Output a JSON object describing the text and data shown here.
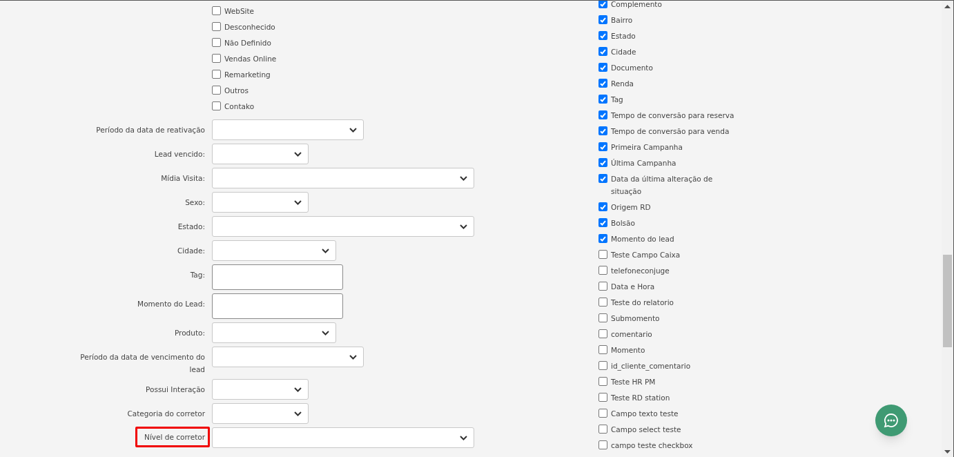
{
  "origin_options": [
    {
      "label": "WebSite",
      "checked": false
    },
    {
      "label": "Desconhecido",
      "checked": false
    },
    {
      "label": "Não Definido",
      "checked": false
    },
    {
      "label": "Vendas Online",
      "checked": false
    },
    {
      "label": "Remarketing",
      "checked": false
    },
    {
      "label": "Outros",
      "checked": false
    },
    {
      "label": "Contako",
      "checked": false
    }
  ],
  "filters": [
    {
      "label": "Período da data de reativação",
      "kind": "select",
      "highlighted": false
    },
    {
      "label": "Lead vencido:",
      "kind": "select",
      "highlighted": false
    },
    {
      "label": "Mídia Visita:",
      "kind": "select",
      "highlighted": false
    },
    {
      "label": "Sexo:",
      "kind": "select",
      "highlighted": false
    },
    {
      "label": "Estado:",
      "kind": "select",
      "highlighted": false
    },
    {
      "label": "Cidade:",
      "kind": "select",
      "highlighted": false
    },
    {
      "label": "Tag:",
      "kind": "textarea",
      "highlighted": false
    },
    {
      "label": "Momento do Lead:",
      "kind": "textarea",
      "highlighted": false
    },
    {
      "label": "Produto:",
      "kind": "select",
      "highlighted": false
    },
    {
      "label": "Período da data de vencimento do lead",
      "kind": "select",
      "highlighted": false
    },
    {
      "label": "Possui Interação",
      "kind": "select",
      "highlighted": false
    },
    {
      "label": "Categoria do corretor",
      "kind": "select",
      "highlighted": false
    },
    {
      "label": "Nível de corretor",
      "kind": "select",
      "highlighted": true
    }
  ],
  "columns": [
    {
      "label": "Complemento",
      "checked": true
    },
    {
      "label": "Bairro",
      "checked": true
    },
    {
      "label": "Estado",
      "checked": true
    },
    {
      "label": "Cidade",
      "checked": true
    },
    {
      "label": "Documento",
      "checked": true
    },
    {
      "label": "Renda",
      "checked": true
    },
    {
      "label": "Tag",
      "checked": true
    },
    {
      "label": "Tempo de conversão para reserva",
      "checked": true
    },
    {
      "label": "Tempo de conversão para venda",
      "checked": true
    },
    {
      "label": "Primeira Campanha",
      "checked": true
    },
    {
      "label": "Última Campanha",
      "checked": true
    },
    {
      "label": "Data da última alteração de situação",
      "checked": true
    },
    {
      "label": "Origem RD",
      "checked": true
    },
    {
      "label": "Bolsão",
      "checked": true
    },
    {
      "label": "Momento do lead",
      "checked": true
    },
    {
      "label": "Teste Campo Caixa",
      "checked": false
    },
    {
      "label": "telefoneconjuge",
      "checked": false
    },
    {
      "label": "Data e Hora",
      "checked": false
    },
    {
      "label": "Teste do relatorio",
      "checked": false
    },
    {
      "label": "Submomento",
      "checked": false
    },
    {
      "label": "comentario",
      "checked": false
    },
    {
      "label": "Momento",
      "checked": false
    },
    {
      "label": "id_cliente_comentario",
      "checked": false
    },
    {
      "label": "Teste HR PM",
      "checked": false
    },
    {
      "label": "Teste RD station",
      "checked": false
    },
    {
      "label": "Campo texto teste",
      "checked": false
    },
    {
      "label": "Campo select teste",
      "checked": false
    },
    {
      "label": "campo teste checkbox",
      "checked": false
    }
  ]
}
